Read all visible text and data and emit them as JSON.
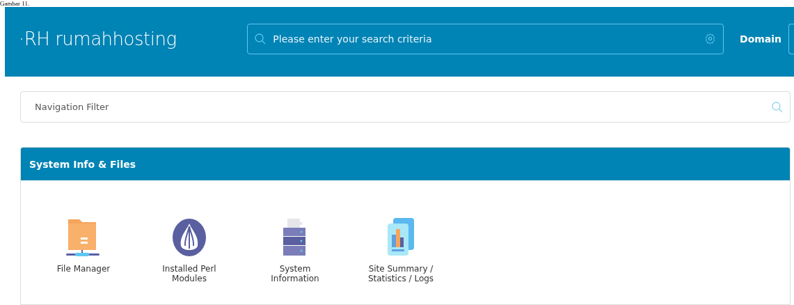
{
  "caption": "Gambar 11.",
  "header": {
    "logo": "·RH rumahhosting",
    "search": {
      "placeholder": "Please enter your search criteria"
    },
    "nav_label": "Domain"
  },
  "navigation_filter": {
    "placeholder": "Navigation Filter"
  },
  "panel": {
    "title": "System Info & Files",
    "items": [
      {
        "kind": "folder",
        "label": "File Manager"
      },
      {
        "kind": "perl",
        "label": "Installed Perl Modules"
      },
      {
        "kind": "server",
        "label": "System Information"
      },
      {
        "kind": "stats",
        "label": "Site Summary / Statistics / Logs"
      }
    ]
  }
}
